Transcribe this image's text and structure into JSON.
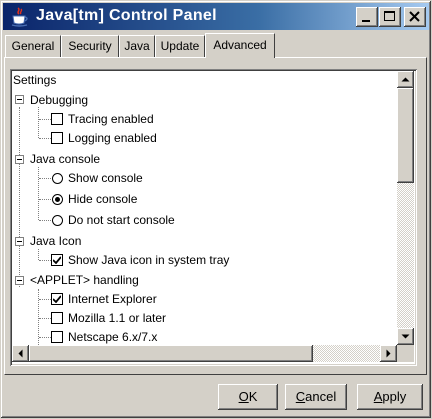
{
  "window": {
    "title": "Java[tm] Control Panel",
    "icon": "java-coffee-cup-icon",
    "controls": [
      "minimize-icon",
      "maximize-icon",
      "close-icon"
    ]
  },
  "tabs": [
    {
      "label": "General",
      "active": false
    },
    {
      "label": "Security",
      "active": false
    },
    {
      "label": "Java",
      "active": false
    },
    {
      "label": "Update",
      "active": false
    },
    {
      "label": "Advanced",
      "active": true
    }
  ],
  "tree": {
    "root": "Settings",
    "debugging": {
      "label": "Debugging",
      "tracing": {
        "label": "Tracing enabled",
        "checked": false
      },
      "logging": {
        "label": "Logging enabled",
        "checked": false
      }
    },
    "java_console": {
      "label": "Java console",
      "show": {
        "label": "Show console",
        "selected": false
      },
      "hide": {
        "label": "Hide console",
        "selected": true
      },
      "dont_start": {
        "label": "Do not start console",
        "selected": false
      }
    },
    "java_icon": {
      "label": "Java Icon",
      "tray": {
        "label": "Show Java icon in system tray",
        "checked": true
      }
    },
    "applet_handling": {
      "label": "<APPLET> handling",
      "ie": {
        "label": "Internet Explorer",
        "checked": true
      },
      "mozilla": {
        "label": "Mozilla 1.1 or later",
        "checked": false
      },
      "netscape": {
        "label": "Netscape 6.x/7.x",
        "checked": false
      }
    }
  },
  "buttons": {
    "ok": {
      "mnemonic": "O",
      "rest": "K"
    },
    "cancel": {
      "mnemonic": "C",
      "rest": "ancel"
    },
    "apply": {
      "mnemonic": "A",
      "rest": "pply"
    }
  },
  "colors": {
    "face": "#d4d0c8",
    "title_gradient_start": "#0a246a",
    "title_gradient_end": "#a6caf0"
  }
}
